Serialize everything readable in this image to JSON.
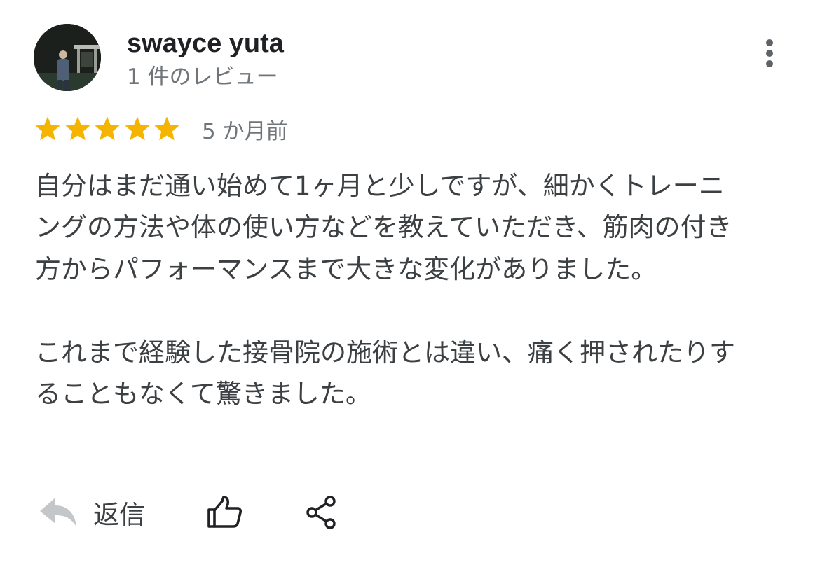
{
  "review": {
    "author_name": "swayce yuta",
    "review_count": "1 件のレビュー",
    "rating": 5,
    "rating_max": 5,
    "date": "5 か月前",
    "paragraphs": [
      "自分はまだ通い始めて1ヶ月と少しですが、細かくトレーニングの方法や体の使い方などを教えていただき、筋肉の付き方からパフォーマンスまで大きな変化がありました。",
      "これまで経験した接骨院の施術とは違い、痛く押されたりすることもなくて驚きました。"
    ]
  },
  "actions": {
    "reply_label": "返信",
    "reply_icon": "reply-arrow-icon",
    "like_icon": "thumbs-up-icon",
    "share_icon": "share-icon",
    "more_icon": "more-vert-icon"
  },
  "colors": {
    "star": "#f4b400",
    "name": "#202124",
    "meta": "#70757a",
    "body": "#3c4043",
    "reply_icon": "#c4c7c9"
  }
}
